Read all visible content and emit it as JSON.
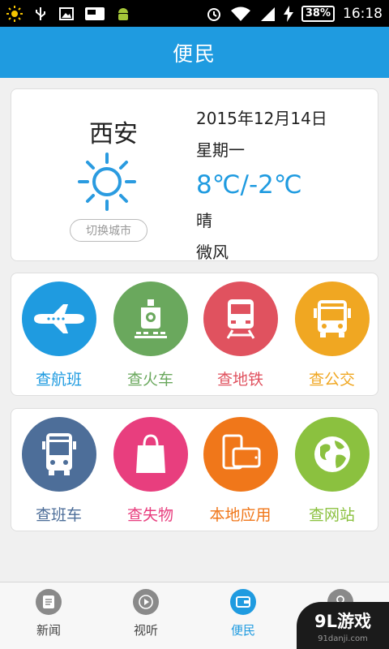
{
  "status_bar": {
    "battery": "38%",
    "time": "16:18"
  },
  "header": {
    "title": "便民"
  },
  "weather": {
    "city": "西安",
    "date": "2015年12月14日",
    "weekday": "星期一",
    "temperature": "8℃/-2℃",
    "condition": "晴",
    "wind": "微风",
    "switch_city_label": "切换城市",
    "condition_icon": "sun-icon"
  },
  "services_row1": [
    {
      "label": "查航班",
      "icon": "airplane-icon",
      "color": "#1f9be0"
    },
    {
      "label": "查火车",
      "icon": "train-icon",
      "color": "#6aa85d"
    },
    {
      "label": "查地铁",
      "icon": "subway-icon",
      "color": "#e0525f"
    },
    {
      "label": "查公交",
      "icon": "bus-icon",
      "color": "#f0a722"
    }
  ],
  "services_row2": [
    {
      "label": "查班车",
      "icon": "coach-icon",
      "color": "#4d6e99"
    },
    {
      "label": "查失物",
      "icon": "shopping-bag-icon",
      "color": "#e83e7e"
    },
    {
      "label": "本地应用",
      "icon": "mobile-apps-icon",
      "color": "#f0771a"
    },
    {
      "label": "查网站",
      "icon": "globe-icon",
      "color": "#8bc13f"
    }
  ],
  "bottom_nav": [
    {
      "label": "新闻",
      "icon": "news-icon",
      "active": false
    },
    {
      "label": "视听",
      "icon": "play-icon",
      "active": false
    },
    {
      "label": "便民",
      "icon": "wallet-icon",
      "active": true
    },
    {
      "label": "",
      "icon": "user-icon",
      "active": false
    }
  ],
  "watermark": {
    "main": "9L游戏",
    "sub": "91danji.com"
  }
}
